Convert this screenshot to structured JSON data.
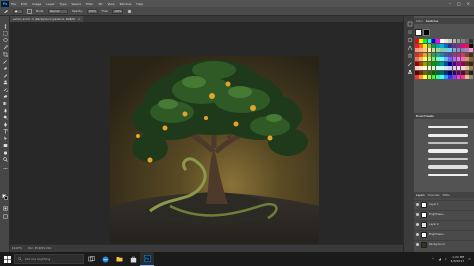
{
  "app": {
    "logo_text": "Ps",
    "menus": [
      "File",
      "Edit",
      "Image",
      "Layer",
      "Type",
      "Select",
      "Filter",
      "3D",
      "View",
      "Window",
      "Help"
    ]
  },
  "options_bar": {
    "tool_icon": "brush-tool-icon",
    "mode_label": "Mode:",
    "mode_value": "Normal",
    "opacity_label": "Opacity:",
    "opacity_value": "100%",
    "flow_label": "Flow:",
    "flow_value": "100%"
  },
  "document": {
    "tab_title": "Lemon and ti..% (Background guidance, RGB/8)",
    "close_label": "×"
  },
  "status": {
    "zoom": "16.67%",
    "doc_info": "Doc: 45.4M/1.01G"
  },
  "panels": {
    "color_tabs": [
      "Color",
      "Swatches"
    ],
    "brush_tabs": [
      "Brush Presets"
    ],
    "layers_tabs": [
      "Layers",
      "Channels",
      "Paths"
    ],
    "layers": [
      {
        "name": "Layer 1"
      },
      {
        "name": "Brightness..."
      },
      {
        "name": "Layer 2"
      },
      {
        "name": "Brightness..."
      },
      {
        "name": "Background"
      }
    ]
  },
  "swatch_colors": [
    "#ff0000",
    "#ffff00",
    "#00ff00",
    "#00ffff",
    "#0000ff",
    "#ff00ff",
    "#ffffff",
    "#e6e6e6",
    "#cccccc",
    "#b3b3b3",
    "#999999",
    "#808080",
    "#666666",
    "#333333",
    "#ed1c24",
    "#f26522",
    "#fff200",
    "#8dc63f",
    "#00a651",
    "#00a99d",
    "#00aeef",
    "#0072bc",
    "#2e3192",
    "#662d91",
    "#92278f",
    "#ec008c",
    "#ed145b",
    "#000000",
    "#f7977a",
    "#f9ad81",
    "#fdc68a",
    "#fff79a",
    "#c4df9b",
    "#a2d39c",
    "#82ca9d",
    "#7bcdc8",
    "#6ecff6",
    "#7ea7d8",
    "#8393ca",
    "#8781bd",
    "#a187be",
    "#f49ac2",
    "#c5342b",
    "#d9531e",
    "#e8a317",
    "#9dbb3a",
    "#3a9a5b",
    "#2a9d8f",
    "#2c7bb6",
    "#3b5ba5",
    "#5a3e99",
    "#8e3b8f",
    "#b5306a",
    "#d6336c",
    "#7a4a2b",
    "#4a2e1a",
    "#ff6666",
    "#ffb366",
    "#ffff66",
    "#b3ff66",
    "#66ff66",
    "#66ffb3",
    "#66ffff",
    "#66b3ff",
    "#6666ff",
    "#b366ff",
    "#ff66ff",
    "#ff66b3",
    "#c69c6d",
    "#8c6239",
    "#990000",
    "#994c00",
    "#999900",
    "#4c9900",
    "#009900",
    "#00994c",
    "#009999",
    "#004c99",
    "#000099",
    "#4c0099",
    "#990099",
    "#99004c",
    "#603913",
    "#3c2415",
    "#ffcccc",
    "#ffe5cc",
    "#ffffcc",
    "#e5ffcc",
    "#ccffcc",
    "#ccffe5",
    "#ccffff",
    "#cce5ff",
    "#ccccff",
    "#e5ccff",
    "#ffccff",
    "#ffcce5",
    "#d7c7a8",
    "#a67c52",
    "#660000",
    "#663300",
    "#666600",
    "#336600",
    "#006600",
    "#006633",
    "#006666",
    "#003366",
    "#000066",
    "#330066",
    "#660066",
    "#660033",
    "#754c24",
    "#231f20",
    "#ff3333",
    "#ff9933",
    "#ffff33",
    "#99ff33",
    "#33ff33",
    "#33ff99",
    "#33ffff",
    "#3399ff",
    "#3333ff",
    "#9933ff",
    "#ff33ff",
    "#ff3399",
    "#e0c080",
    "#998675"
  ],
  "taskbar": {
    "search_placeholder": "Ask me anything",
    "time": "1:22 PM",
    "date": "4/3/2017"
  },
  "icons": {
    "start": "windows-start-icon",
    "search": "search-icon",
    "apps": [
      "task-view-icon",
      "edge-browser-icon",
      "file-explorer-icon",
      "store-icon",
      "photoshop-icon"
    ]
  }
}
